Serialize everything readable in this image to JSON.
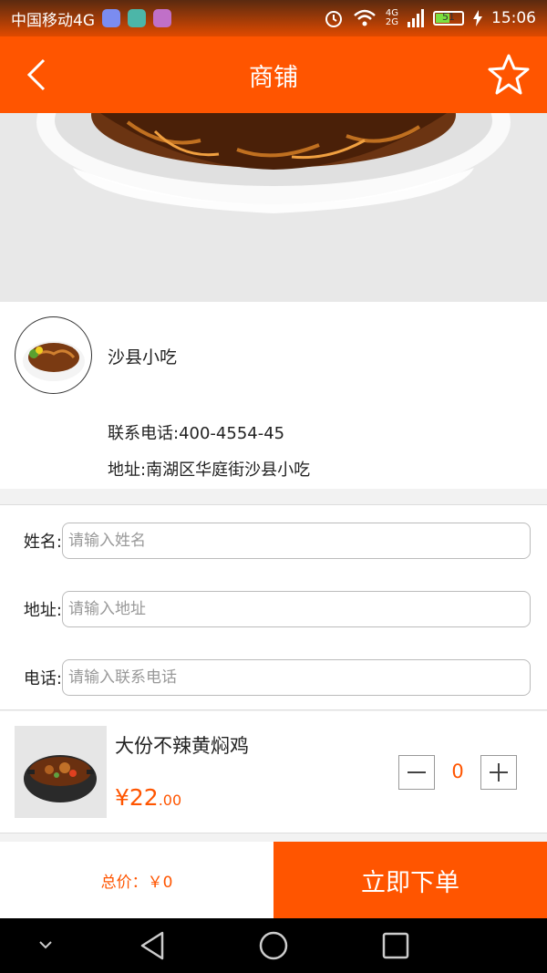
{
  "status_bar": {
    "carrier": "中国移动4G",
    "battery_level": "51",
    "time": "15:06",
    "network_top": "4G",
    "network_bottom": "2G"
  },
  "nav": {
    "title": "商铺"
  },
  "shop": {
    "name": "沙县小吃",
    "phone": "联系电话:400-4554-45",
    "address": "地址:南湖区华庭街沙县小吃"
  },
  "form": {
    "name_label": "姓名:",
    "name_placeholder": "请输入姓名",
    "address_label": "地址:",
    "address_placeholder": "请输入地址",
    "phone_label": "电话:",
    "phone_placeholder": "请输入联系电话"
  },
  "product": {
    "name": "大份不辣黄焖鸡",
    "price_main": "¥22",
    "price_decimal": ".00",
    "quantity": "0"
  },
  "order": {
    "total": "总价：￥0",
    "submit_label": "立即下单"
  },
  "colors": {
    "accent": "#ff5500"
  }
}
